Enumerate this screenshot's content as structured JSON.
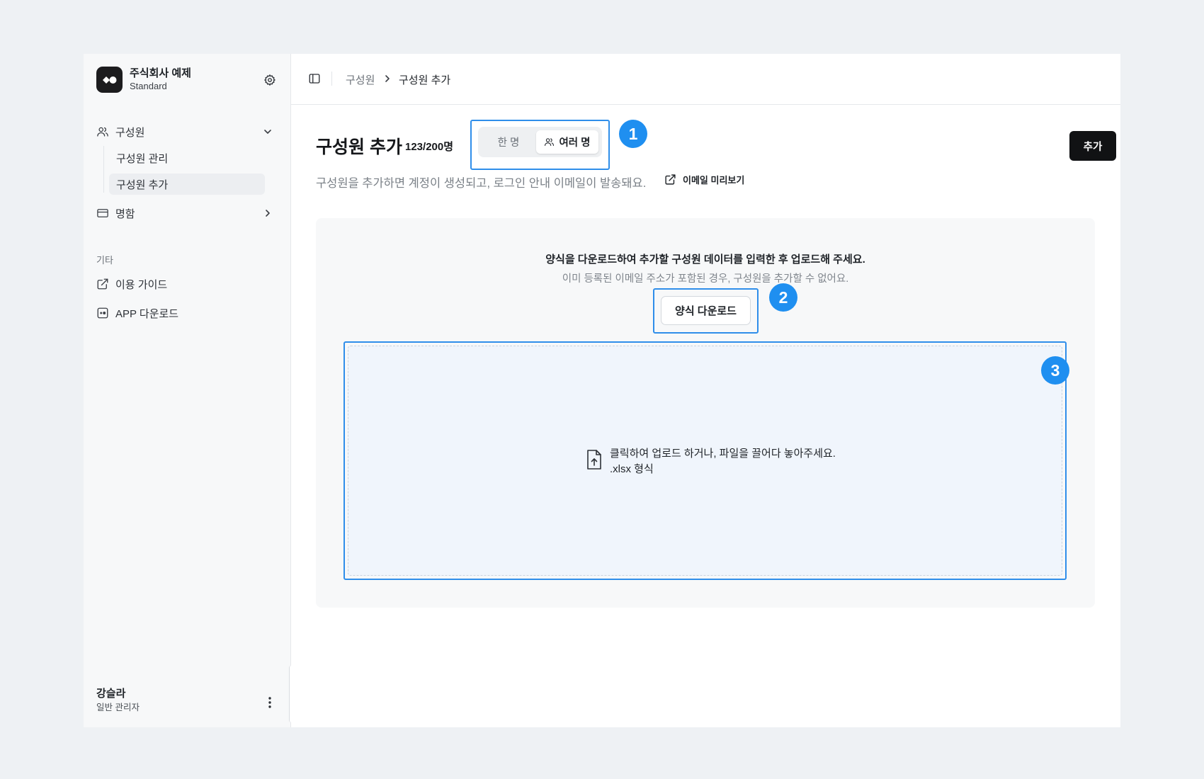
{
  "sidebar": {
    "org_name": "주식회사 예제",
    "org_plan": "Standard",
    "nav": {
      "members": {
        "label": "구성원",
        "children": [
          "구성원 관리",
          "구성원 추가"
        ]
      },
      "cards": {
        "label": "명함"
      }
    },
    "section_label": "기타",
    "extra": [
      "이용 가이드",
      "APP 다운로드"
    ],
    "user": {
      "name": "강슬라",
      "role": "일반 관리자"
    }
  },
  "breadcrumb": [
    "구성원",
    "구성원 추가"
  ],
  "header": {
    "title": "구성원 추가",
    "count": "123/200명",
    "segment": {
      "options": [
        "한 명",
        "여러 명"
      ],
      "selected": "여러 명"
    },
    "subtitle": "구성원을 추가하면 계정이 생성되고, 로그인 안내 이메일이 발송돼요.",
    "preview_link": "이메일 미리보기",
    "add_button": "추가"
  },
  "panel": {
    "instruction": "양식을 다운로드하여 추가할 구성원 데이터를 입력한 후 업로드해 주세요.",
    "note": "이미 등록된 이메일 주소가 포함된 경우, 구성원을 추가할 수 없어요.",
    "download_button": "양식 다운로드",
    "dropzone": {
      "line1": "클릭하여 업로드 하거나, 파일을 끌어다 놓아주세요.",
      "line2": ".xlsx 형식"
    }
  },
  "annotations": [
    "1",
    "2",
    "3"
  ],
  "colors": {
    "highlight": "#2f8eea",
    "badge": "#1f8ff0",
    "primary_button": "#111214"
  },
  "icons": [
    "app-logo-icon",
    "gear-icon",
    "users-icon",
    "chevron-down-icon",
    "card-icon",
    "chevron-right-icon",
    "external-link-icon",
    "app-download-icon",
    "more-vertical-icon",
    "sidebar-toggle-icon",
    "file-upload-icon"
  ]
}
